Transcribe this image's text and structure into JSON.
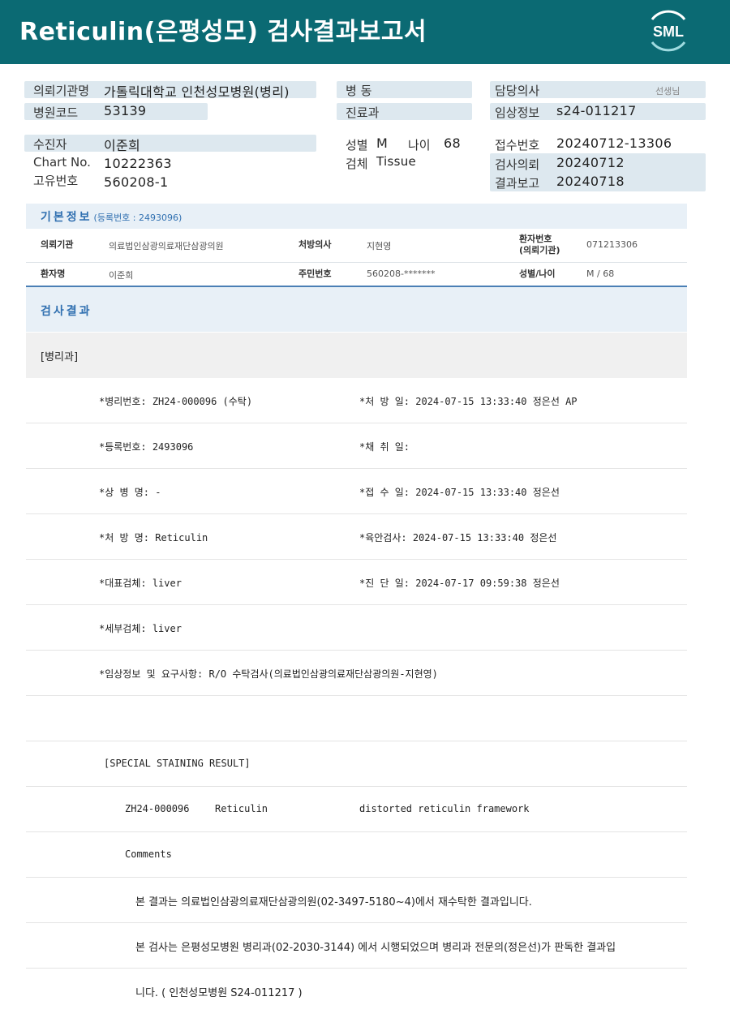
{
  "header": {
    "title": "Reticulin(은평성모) 검사결과보고서",
    "logo_text": "SML"
  },
  "info": {
    "col1": [
      {
        "label": "의뢰기관명",
        "value": "가톨릭대학교 인천성모병원(병리)"
      },
      {
        "label": "병원코드",
        "value": "53139"
      }
    ],
    "col2": [
      {
        "label": "병  동",
        "value": ""
      },
      {
        "label": "진료과",
        "value": ""
      }
    ],
    "col3": [
      {
        "label": "담당의사",
        "value": "",
        "suffix": "선생님"
      },
      {
        "label": "임상정보",
        "value": "s24-011217"
      }
    ],
    "patient": {
      "label": "수진자",
      "value": "이준희"
    },
    "chart_no": {
      "label": "Chart No.",
      "value": "10222363"
    },
    "unique_no": {
      "label": "고유번호",
      "value": "560208-1"
    },
    "sex": {
      "label": "성별",
      "value": "M"
    },
    "age": {
      "label": "나이",
      "value": "68"
    },
    "specimen": {
      "label": "검체",
      "value": "Tissue"
    },
    "receipt_no": {
      "label": "접수번호",
      "value": "20240712-13306"
    },
    "request_date": {
      "label": "검사의뢰",
      "value": "20240712"
    },
    "report_date": {
      "label": "결과보고",
      "value": "20240718"
    }
  },
  "basic_info": {
    "title": "기본정보",
    "subtitle": "(등록번호 : 2493096)",
    "row1": {
      "inst_label": "의뢰기관",
      "inst_value": "의료법인삼광의료재단삼광의원",
      "doctor_label": "처방의사",
      "doctor_value": "지현영",
      "pid_label_1": "환자번호",
      "pid_label_2": "(의뢰기관)",
      "pid_value": "071213306"
    },
    "row2": {
      "name_label": "환자명",
      "name_value": "이준희",
      "rrn_label": "주민번호",
      "rrn_value": "560208-*******",
      "sexage_label": "성별/나이",
      "sexage_value": "M / 68"
    }
  },
  "result": {
    "title": "검사결과",
    "dept": "[병리과]",
    "rows": [
      {
        "left": "*병리번호: ZH24-000096 (수탁)",
        "right": "*처 방 일: 2024-07-15 13:33:40  정은선 AP"
      },
      {
        "left": "*등록번호: 2493096",
        "right": "*채 취 일:"
      },
      {
        "left": "*상 병 명: -",
        "right": "*접 수 일: 2024-07-15 13:33:40  정은선"
      },
      {
        "left": "*처 방 명: Reticulin",
        "right": "*육안검사: 2024-07-15 13:33:40  정은선"
      },
      {
        "left": "*대표검체: liver",
        "right": "*진 단 일: 2024-07-17 09:59:38  정은선"
      },
      {
        "left": "*세부검체: liver",
        "right": ""
      },
      {
        "left": "*임상정보 및 요구사항: R/O 수탁검사(의료법인삼광의료재단삼광의원-지현영)",
        "right": ""
      }
    ],
    "staining_header": "[SPECIAL STAINING RESULT]",
    "staining": {
      "code": "ZH24-000096",
      "stain": "Reticulin",
      "result": "distorted reticulin framework"
    },
    "comments_label": "Comments",
    "comment_lines": [
      "본 결과는 의료법인삼광의료재단삼광의원(02-3497-5180~4)에서 재수탁한 결과입니다.",
      "본 검사는 은평성모병원 병리과(02-2030-3144) 에서 시행되었으며 병리과 전문의(정은선)가 판독한 결과입",
      "니다. ( 인천성모병원 S24-011217 )"
    ]
  },
  "colors": {
    "header_bg": "#0b6a73",
    "pill_bg": "#dde8ef",
    "section_bg": "#e8f0f7",
    "accent_blue": "#2f6fb0"
  }
}
